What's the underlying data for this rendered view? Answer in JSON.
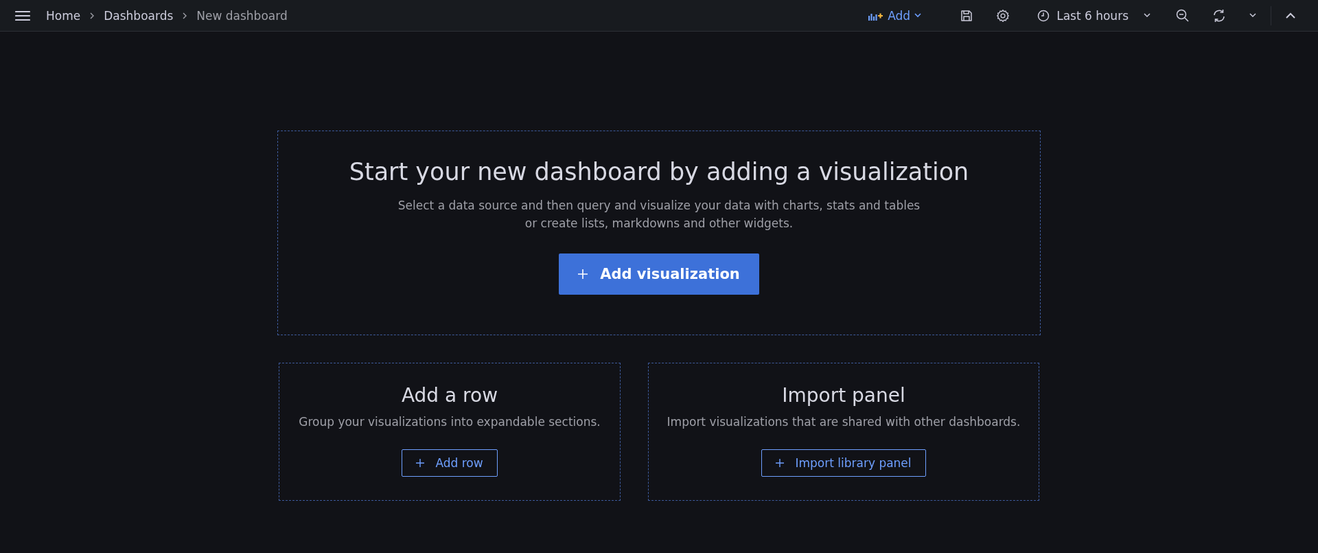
{
  "breadcrumbs": [
    {
      "label": "Home",
      "current": false
    },
    {
      "label": "Dashboards",
      "current": false
    },
    {
      "label": "New dashboard",
      "current": true
    }
  ],
  "toolbar": {
    "add_label": "Add",
    "time_range": "Last 6 hours"
  },
  "main_card": {
    "title": "Start your new dashboard by adding a visualization",
    "description_lines": [
      "Select a data source and then query and visualize your data with charts, stats and tables",
      "or create lists, markdowns and other widgets."
    ],
    "button": "Add visualization"
  },
  "cards": [
    {
      "title": "Add a row",
      "description": "Group your visualizations into expandable sections.",
      "button": "Add row"
    },
    {
      "title": "Import panel",
      "description": "Import visualizations that are shared with other dashboards.",
      "button": "Import library panel"
    }
  ]
}
